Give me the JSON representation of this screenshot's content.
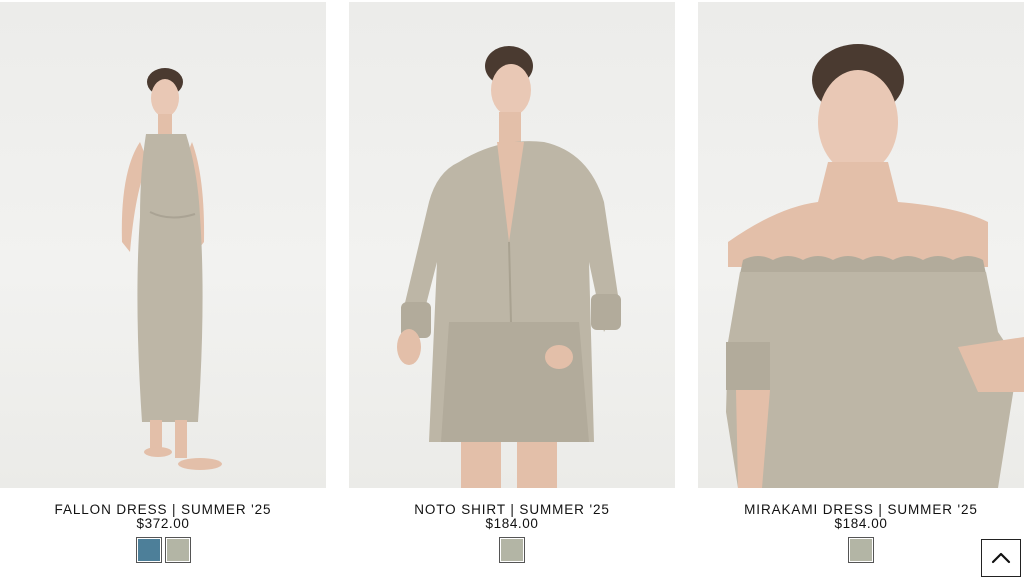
{
  "products": [
    {
      "title": "FALLON DRESS | SUMMER '25",
      "price": "$372.00",
      "swatches": [
        {
          "name": "blue",
          "color": "#4d7f99"
        },
        {
          "name": "sage",
          "color": "#b3b5a5"
        }
      ]
    },
    {
      "title": "NOTO SHIRT | SUMMER '25",
      "price": "$184.00",
      "swatches": [
        {
          "name": "sage",
          "color": "#b3b5a5"
        }
      ]
    },
    {
      "title": "MIRAKAMI DRESS | SUMMER '25",
      "price": "$184.00",
      "swatches": [
        {
          "name": "sage",
          "color": "#b3b5a5"
        }
      ]
    }
  ],
  "back_to_top": {
    "icon": "chevron-up-icon"
  },
  "colors": {
    "garment": "#bdb6a6",
    "skin": "#e9c8b5",
    "hair": "#4a3a30",
    "background": "#efefed"
  }
}
